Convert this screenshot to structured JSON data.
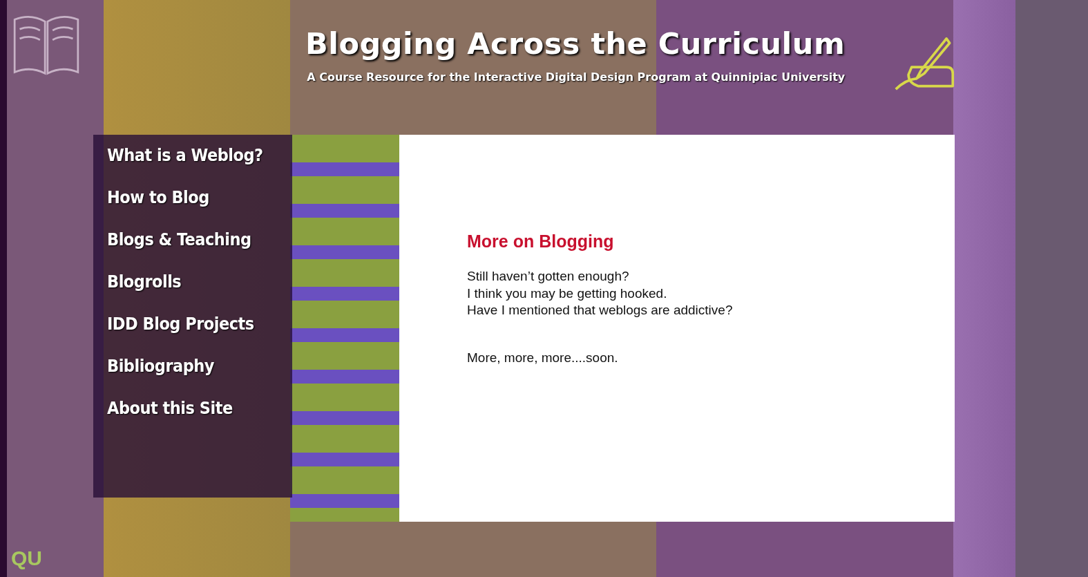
{
  "header": {
    "title": "Blogging Across the Curriculum",
    "subtitle": "A Course Resource for the Interactive Digital Design Program at Quinnipiac University"
  },
  "nav": [
    "What is a Weblog?",
    "How to Blog",
    "Blogs & Teaching",
    "Blogrolls",
    "IDD Blog Projects",
    "Bibliography",
    "About this Site"
  ],
  "content": {
    "heading": "More on Blogging",
    "paragraphs": [
      [
        "Still haven’t gotten enough?",
        "I think you may be getting hooked.",
        "Have I mentioned that weblogs are addictive?"
      ],
      [
        "More, more, more....soon."
      ]
    ]
  },
  "logo": "QU"
}
